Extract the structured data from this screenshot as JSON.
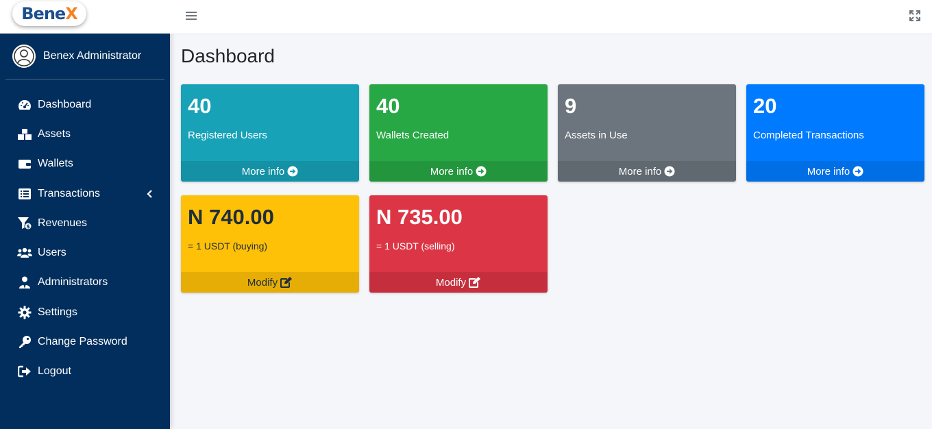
{
  "brand": {
    "logo_text": "Bene",
    "logo_x": "X"
  },
  "user": {
    "name": "Benex Administrator"
  },
  "sidebar": {
    "items": [
      {
        "label": "Dashboard",
        "icon": "tachometer-icon"
      },
      {
        "label": "Assets",
        "icon": "boxes-icon"
      },
      {
        "label": "Wallets",
        "icon": "wallet-icon"
      },
      {
        "label": "Transactions",
        "icon": "list-alt-icon"
      },
      {
        "label": "Revenues",
        "icon": "funnel-dollar-icon"
      },
      {
        "label": "Users",
        "icon": "users-icon"
      },
      {
        "label": "Administrators",
        "icon": "user-tie-icon"
      },
      {
        "label": "Settings",
        "icon": "cog-icon"
      },
      {
        "label": "Change Password",
        "icon": "key-icon"
      },
      {
        "label": "Logout",
        "icon": "sign-out-icon"
      }
    ]
  },
  "page": {
    "title": "Dashboard"
  },
  "cards": [
    {
      "value": "40",
      "label": "Registered Users",
      "footer": "More info",
      "color": "#17a2b8"
    },
    {
      "value": "40",
      "label": "Wallets Created",
      "footer": "More info",
      "color": "#28a745"
    },
    {
      "value": "9",
      "label": "Assets in Use",
      "footer": "More info",
      "color": "#6c757d"
    },
    {
      "value": "20",
      "label": "Completed Transactions",
      "footer": "More info",
      "color": "#007bff"
    },
    {
      "value": "N 740.00",
      "label": "= 1 USDT (buying)",
      "footer": "Modify",
      "color": "#ffc107"
    },
    {
      "value": "N 735.00",
      "label": "= 1 USDT (selling)",
      "footer": "Modify",
      "color": "#dc3545"
    }
  ],
  "colors": {
    "sidebar_bg": "#012e5c",
    "page_bg": "#f4f6f9",
    "logo_blue": "#1d4e8f",
    "logo_orange": "#f58220"
  }
}
